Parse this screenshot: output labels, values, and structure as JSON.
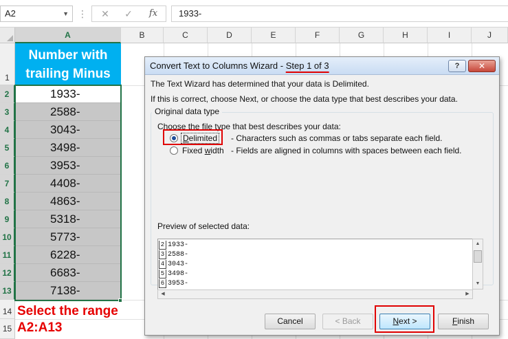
{
  "formula_bar": {
    "name_box": "A2",
    "name_box_arrow": "▼",
    "grip": "⋮",
    "cancel_symbol": "✕",
    "enter_symbol": "✓",
    "fx_symbol": "fx",
    "formula": "1933-"
  },
  "columns": [
    "A",
    "B",
    "C",
    "D",
    "E",
    "F",
    "G",
    "H",
    "I",
    "J"
  ],
  "rows": [
    "1",
    "2",
    "3",
    "4",
    "5",
    "6",
    "7",
    "8",
    "9",
    "10",
    "11",
    "12",
    "13",
    "14",
    "15"
  ],
  "sheet": {
    "header_line1": "Number with",
    "header_line2": "trailing Minus",
    "values": [
      "1933-",
      "2588-",
      "3043-",
      "3498-",
      "3953-",
      "4408-",
      "4863-",
      "5318-",
      "5773-",
      "6228-",
      "6683-",
      "7138-"
    ],
    "instruction_line1": "Select the range",
    "instruction_line2": "A2:A13"
  },
  "colors": {
    "header_fill": "#00b0f0",
    "selection_fill": "#c7c7c7",
    "selection_border": "#217346",
    "annotation_red": "#e60000"
  },
  "wizard": {
    "title_prefix": "Convert Text to Columns Wizard - ",
    "title_step": "Step 1 of 3",
    "help_label": "?",
    "close_label": "✕",
    "line1": "The Text Wizard has determined that your data is Delimited.",
    "line2": "If this is correct, choose Next, or choose the data type that best describes your data.",
    "group_title": "Original data type",
    "choose_label": "Choose the file type that best describes your data:",
    "delimited_label_u": "D",
    "delimited_label_rest": "elimited",
    "delimited_desc": "- Characters such as commas or tabs separate each field.",
    "fixed_label_pre": "Fixed ",
    "fixed_label_u": "w",
    "fixed_label_rest": "idth",
    "fixed_desc": "- Fields are aligned in columns with spaces between each field.",
    "selected_option": "Delimited",
    "preview_label": "Preview of selected data:",
    "preview_rows": [
      {
        "num": "2",
        "val": "1933-"
      },
      {
        "num": "3",
        "val": "2588-"
      },
      {
        "num": "4",
        "val": "3043-"
      },
      {
        "num": "5",
        "val": "3498-"
      },
      {
        "num": "6",
        "val": "3953-"
      }
    ],
    "scroll_up": "▲",
    "scroll_down": "▼",
    "scroll_left": "◀",
    "scroll_right": "▶",
    "buttons": {
      "cancel": "Cancel",
      "back": "< Back",
      "next_u": "N",
      "next_rest": "ext >",
      "finish_u": "F",
      "finish_rest": "inish"
    }
  }
}
